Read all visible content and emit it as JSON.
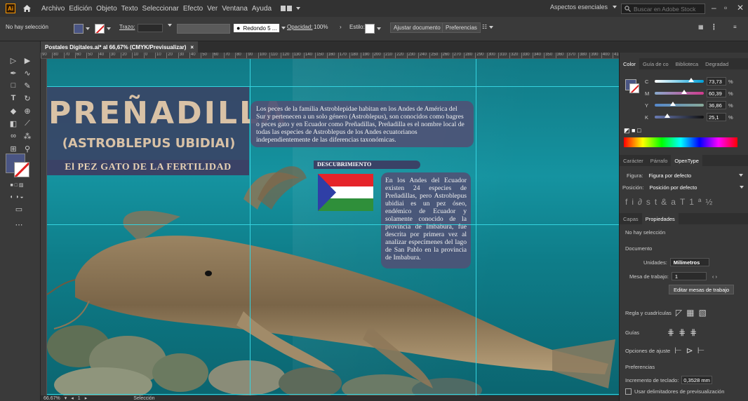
{
  "app": {
    "logo": "Ai"
  },
  "menu": [
    "Archivo",
    "Edición",
    "Objeto",
    "Texto",
    "Seleccionar",
    "Efecto",
    "Ver",
    "Ventana",
    "Ayuda"
  ],
  "workspace": "Aspectos esenciales",
  "search": {
    "placeholder": "Buscar en Adobe Stock"
  },
  "control": {
    "no_selection": "No hay selección",
    "stroke_label": "Trazo:",
    "brush": "Redondo 5 ...",
    "opacity_label": "Opacidad:",
    "opacity_value": "100%",
    "style_label": "Estilo:",
    "adjust_doc": "Ajustar documento",
    "prefs": "Preferencias"
  },
  "document_tab": {
    "title": "Postales Digitales.ai* al 66,67% (CMYK/Previsualizar)",
    "close": "×"
  },
  "ruler": {
    "ticks": [
      "90",
      "80",
      "70",
      "60",
      "50",
      "40",
      "30",
      "20",
      "10",
      "0",
      "10",
      "20",
      "30",
      "40",
      "50",
      "60",
      "70",
      "80",
      "90",
      "100",
      "110",
      "120",
      "130",
      "140",
      "150",
      "160",
      "170",
      "180",
      "190",
      "200",
      "210",
      "220",
      "230",
      "240",
      "250",
      "260",
      "270",
      "280",
      "290",
      "300",
      "310",
      "320",
      "330",
      "340",
      "350",
      "360",
      "370",
      "380",
      "390",
      "400",
      "410"
    ]
  },
  "artboard": {
    "title": "PREÑADILLA",
    "subtitle": "(ASTROBLEPUS UBIDIAI)",
    "tagline": "El PEZ GATO  DE LA FERTILIDAD",
    "intro": "Los peces de la familia Astroblepidae habitan en los Andes de América del Sur y pertenecen a un solo género (Astroblepus), son conocidos como bagres o peces gato y en Ecuador como Preñadillas, Preñadilla es el nombre local de todas las especies de Astroblepus de los Andes ecuatorianos independientemente de las diferencias taxonómicas.",
    "discovery_heading": "DESCUBRIMIENTO",
    "discovery_text": "En los Andes del Ecuador existen 24 especies de Preñadillas, pero Astroblepus ubidiai es un pez óseo, endémico de Ecuador y solamente conocido de la provincia de Imbabura, fue descrita por primera vez al analizar especímenes del lago de San Pablo en la provincia de Imbabura."
  },
  "status": {
    "zoom": "66.67%",
    "page": "1",
    "tool": "Selección"
  },
  "panel": {
    "color_tabs": [
      "Color",
      "Guía de co",
      "Biblioteca",
      "Degradad"
    ],
    "cmyk": [
      {
        "label": "C",
        "value": "73,73",
        "unit": "%",
        "color": "#00a0d8",
        "fill": 0.737
      },
      {
        "label": "M",
        "value": "60,39",
        "unit": "%",
        "color": "#d03a8c",
        "fill": 0.604
      },
      {
        "label": "Y",
        "value": "36,86",
        "unit": "%",
        "color": "#e8d800",
        "fill": 0.369
      },
      {
        "label": "K",
        "value": "25,1",
        "unit": "%",
        "color": "#222222",
        "fill": 0.251
      }
    ],
    "char_tabs": [
      "Carácter",
      "Párrafo",
      "OpenType"
    ],
    "figura_label": "Figura:",
    "figura_value": "Figura por defecto",
    "posicion_label": "Posición:",
    "posicion_value": "Posición por defecto",
    "props_tabs": [
      "Capas",
      "Propiedades"
    ],
    "no_selection": "No hay selección",
    "documento": "Documento",
    "units_label": "Unidades:",
    "units_value": "Milímetros",
    "artboard_label": "Mesa de trabajo:",
    "artboard_value": "1",
    "edit_artboards": "Editar mesas de trabajo",
    "rulers_grids": "Regla y cuadrículas",
    "guides": "Guías",
    "snap": "Opciones de ajuste",
    "preferences": "Preferencias",
    "keyboard_inc_label": "Incremento de teclado:",
    "keyboard_inc_value": "0,3528 mm",
    "preview_bounds": "Usar delimitadores de previsualización"
  },
  "colors": {
    "accent": "#ff9a00",
    "title_box": "#3a4266",
    "title_text": "#d9c2a6",
    "guide": "#35d3df"
  }
}
